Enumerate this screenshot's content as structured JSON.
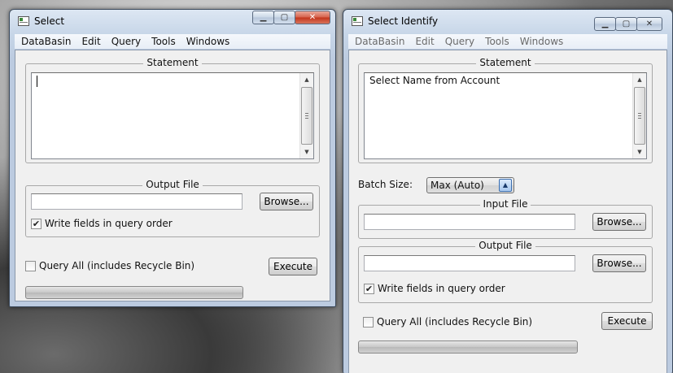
{
  "windows": {
    "select": {
      "title": "Select",
      "menu": [
        "DataBasin",
        "Edit",
        "Query",
        "Tools",
        "Windows"
      ],
      "statement_label": "Statement",
      "statement_text": "",
      "output_file_label": "Output File",
      "output_file_value": "",
      "browse_label": "Browse...",
      "write_fields_label": "Write fields in query order",
      "write_fields_checked": true,
      "query_all_label": "Query All (includes Recycle Bin)",
      "query_all_checked": false,
      "execute_label": "Execute",
      "progress": 0
    },
    "select_identify": {
      "title": "Select Identify",
      "menu": [
        "DataBasin",
        "Edit",
        "Query",
        "Tools",
        "Windows"
      ],
      "statement_label": "Statement",
      "statement_text": "Select Name from Account",
      "batch_size_label": "Batch Size:",
      "batch_size_value": "Max (Auto)",
      "input_file_label": "Input File",
      "input_file_value": "",
      "output_file_label": "Output File",
      "output_file_value": "",
      "browse_label": "Browse...",
      "write_fields_label": "Write fields in query order",
      "write_fields_checked": true,
      "query_all_label": "Query All (includes Recycle Bin)",
      "query_all_checked": false,
      "execute_label": "Execute",
      "progress": 0
    }
  },
  "icons": {
    "minimize": "minimize-icon",
    "maximize": "maximize-icon",
    "close": "close-icon",
    "checkmark": "✔"
  }
}
